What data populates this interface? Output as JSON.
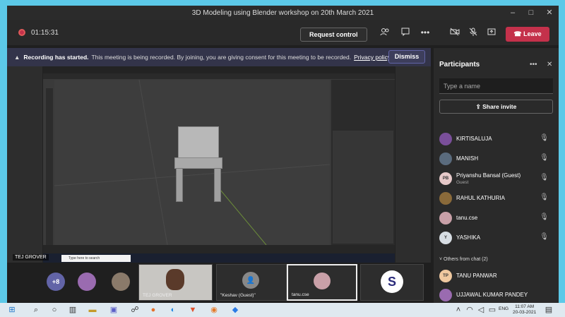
{
  "window": {
    "title": "3D Modeling using Blender workshop on 20th March 2021",
    "controls": [
      "–",
      "□",
      "✕"
    ]
  },
  "meeting_bar": {
    "timer": "01:15:31",
    "request_control_label": "Request control",
    "leave_label": "Leave",
    "icons": [
      "people-icon",
      "chat-icon",
      "more-icon",
      "camera-off-icon",
      "mic-off-icon",
      "share-tray-icon",
      "phone-icon"
    ]
  },
  "banner": {
    "bold": "Recording has started.",
    "text": "This meeting is being recorded. By joining, you are giving consent for this meeting to be recorded.",
    "link": "Privacy policy",
    "dismiss_label": "Dismiss"
  },
  "shared_screen": {
    "presenter_name": "TEJ GROVER",
    "search_placeholder": "Type here to search"
  },
  "gallery": {
    "overflow_count": "+8",
    "tiles": [
      {
        "label": "TEJ GROVER"
      },
      {
        "label": "\"Keshav (Guest)\""
      },
      {
        "label": "tanu.cse"
      },
      {
        "label": "S"
      }
    ]
  },
  "participants_panel": {
    "title": "Participants",
    "more": "•••",
    "close": "✕",
    "search_placeholder": "Type a name",
    "share_invite_label": "Share invite",
    "people": [
      {
        "name": "KIRTISALUJA",
        "sub": "",
        "avatar_color": "#7a4f9a"
      },
      {
        "name": "MANISH",
        "sub": "",
        "avatar_color": "#5a6b7d"
      },
      {
        "name": "Priyanshu Bansal (Guest)",
        "sub": "Guest",
        "initials": "PB",
        "avatar_color": "#e6c9c9"
      },
      {
        "name": "RAHUL KATHURIA",
        "sub": "",
        "avatar_color": "#8a6a3a"
      },
      {
        "name": "tanu.cse",
        "sub": "",
        "avatar_color": "#c9a0a8"
      },
      {
        "name": "YASHIKA",
        "sub": "",
        "initials": "Y",
        "avatar_color": "#d7dde3"
      }
    ],
    "others_section": "Others from chat (2)",
    "others": [
      {
        "name": "TANU PANWAR",
        "initials": "TP",
        "avatar_color": "#f0c9a0"
      },
      {
        "name": "UJJAWAL KUMAR PANDEY",
        "avatar_color": "#9a6bb0"
      }
    ]
  },
  "os_taskbar": {
    "search_icon": "⌕",
    "time": "11:07 AM",
    "date": "20-03-2021",
    "lang": "ENG"
  },
  "colors": {
    "accent": "#6264a7",
    "leave": "#c4314b",
    "panel": "#2a2a2a"
  }
}
